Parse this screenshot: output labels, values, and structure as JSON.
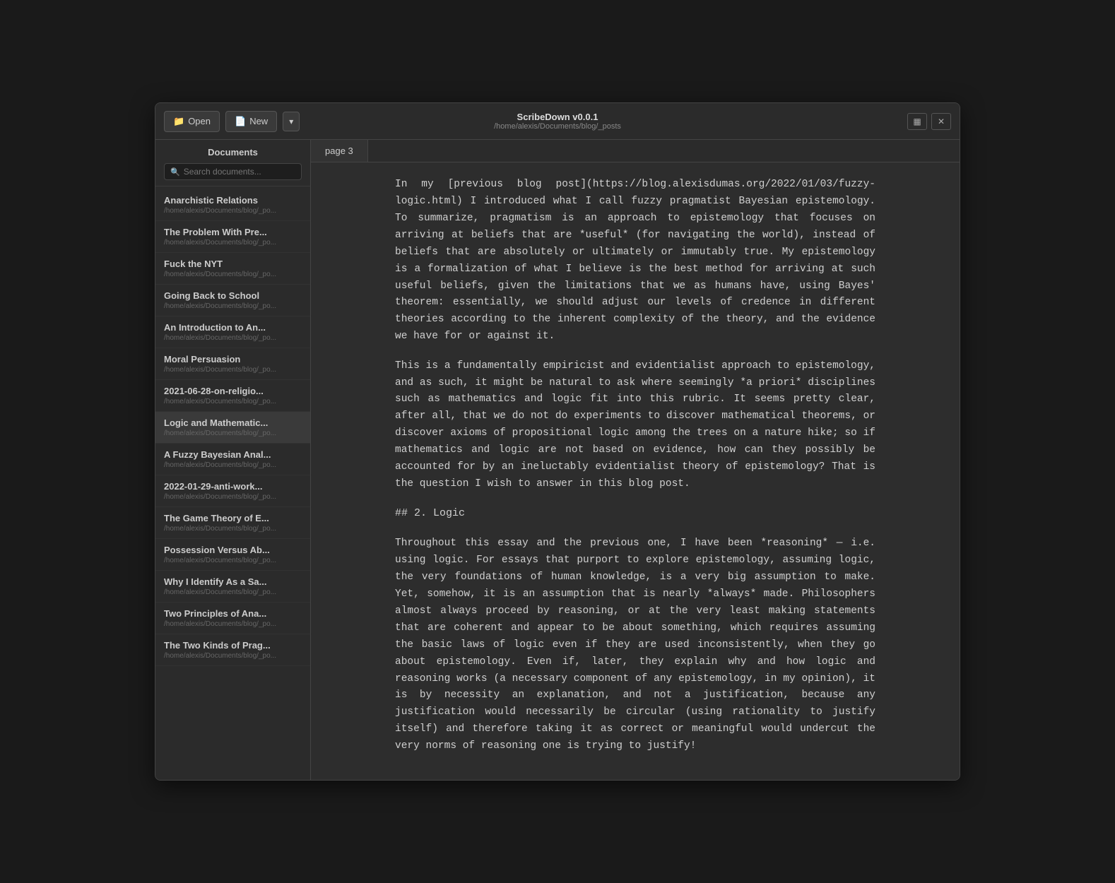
{
  "app": {
    "title": "ScribeDown v0.0.1",
    "subtitle": "/home/alexis/Documents/blog/_posts",
    "open_label": "Open",
    "new_label": "New",
    "open_icon": "📁",
    "new_icon": "📄",
    "grid_icon": "▦",
    "close_icon": "✕"
  },
  "sidebar": {
    "title": "Documents",
    "search_placeholder": "Search documents...",
    "documents": [
      {
        "title": "Anarchistic Relations",
        "path": "/home/alexis/Documents/blog/_po..."
      },
      {
        "title": "The Problem With Pre...",
        "path": "/home/alexis/Documents/blog/_po..."
      },
      {
        "title": "Fuck the NYT",
        "path": "/home/alexis/Documents/blog/_po..."
      },
      {
        "title": "Going Back to School",
        "path": "/home/alexis/Documents/blog/_po..."
      },
      {
        "title": "An Introduction to An...",
        "path": "/home/alexis/Documents/blog/_po..."
      },
      {
        "title": "Moral Persuasion",
        "path": "/home/alexis/Documents/blog/_po..."
      },
      {
        "title": "2021-06-28-on-religio...",
        "path": "/home/alexis/Documents/blog/_po..."
      },
      {
        "title": "Logic and Mathematic...",
        "path": "/home/alexis/Documents/blog/_po...",
        "active": true
      },
      {
        "title": "A Fuzzy Bayesian Anal...",
        "path": "/home/alexis/Documents/blog/_po..."
      },
      {
        "title": "2022-01-29-anti-work...",
        "path": "/home/alexis/Documents/blog/_po..."
      },
      {
        "title": "The Game Theory of E...",
        "path": "/home/alexis/Documents/blog/_po..."
      },
      {
        "title": "Possession Versus Ab...",
        "path": "/home/alexis/Documents/blog/_po..."
      },
      {
        "title": "Why I Identify As a Sa...",
        "path": "/home/alexis/Documents/blog/_po..."
      },
      {
        "title": "Two Principles of Ana...",
        "path": "/home/alexis/Documents/blog/_po..."
      },
      {
        "title": "The Two Kinds of Prag...",
        "path": "/home/alexis/Documents/blog/_po..."
      }
    ]
  },
  "content": {
    "tab_label": "page 3",
    "paragraphs": [
      "In my [previous blog post](https://blog.alexisdumas.org/2022/01/03/fuzzy-logic.html) I introduced what I call fuzzy pragmatist Bayesian epistemology. To summarize, pragmatism is an approach to epistemology that focuses on arriving at beliefs that are *useful* (for navigating the world), instead of beliefs that are absolutely or ultimately or immutably true. My epistemology is a formalization of what I believe is the best method for arriving at such useful beliefs, given the limitations that we as humans have, using Bayes' theorem: essentially, we should adjust our levels of credence in different theories according to the inherent complexity of the theory, and the evidence we have for or against it.",
      "This is a fundamentally empiricist and evidentialist approach to epistemology, and as such, it might be natural to ask where seemingly *a priori* disciplines such as mathematics and logic fit into this rubric. It seems pretty clear, after all, that we do not do experiments to discover mathematical theorems, or discover axioms of propositional logic among the trees on a nature hike; so if mathematics and logic are not based on evidence, how can they possibly be accounted for by an ineluctably evidentialist theory of epistemology? That is the question I wish to answer in this blog post.",
      "## 2. Logic",
      "Throughout this essay and the previous one, I have been *reasoning* — i.e. using logic. For essays that purport to explore epistemology, assuming logic, the very foundations of human knowledge, is a very big assumption to make. Yet, somehow, it is an assumption that is nearly *always* made. Philosophers almost always proceed by reasoning, or at the very least making statements that are coherent and appear to be about something, which requires assuming the basic laws of logic even if they are used inconsistently, when they go about epistemology. Even if, later, they explain why and how logic and reasoning works (a necessary component of any epistemology, in my opinion), it is by necessity an explanation, and not a justification, because any justification would necessarily be circular (using rationality to justify itself) and therefore taking it as correct or meaningful would undercut the very norms of reasoning one is trying to justify!"
    ]
  }
}
